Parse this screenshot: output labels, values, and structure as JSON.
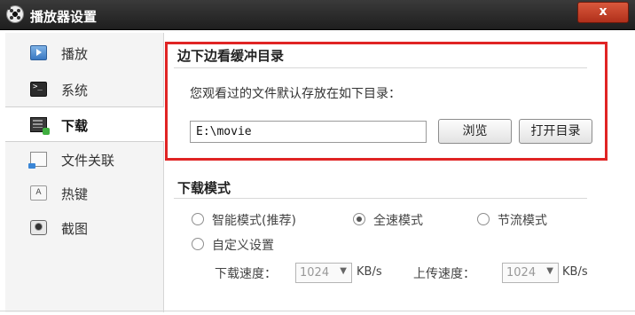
{
  "window": {
    "title": "播放器设置",
    "close_label": "x"
  },
  "sidebar": {
    "items": [
      {
        "label": "播放",
        "icon": "play-icon"
      },
      {
        "label": "系统",
        "icon": "terminal-icon"
      },
      {
        "label": "下载",
        "icon": "download-icon",
        "active": true
      },
      {
        "label": "文件关联",
        "icon": "file-icon"
      },
      {
        "label": "热键",
        "icon": "keyboard-icon"
      },
      {
        "label": "截图",
        "icon": "camera-icon"
      }
    ]
  },
  "buffer_dir": {
    "title": "边下边看缓冲目录",
    "description": "您观看过的文件默认存放在如下目录：",
    "path": "E:\\movie",
    "browse_label": "浏览",
    "open_label": "打开目录"
  },
  "download_mode": {
    "title": "下载模式",
    "options": [
      {
        "label": "智能模式(推荐)",
        "checked": false
      },
      {
        "label": "全速模式",
        "checked": true
      },
      {
        "label": "节流模式",
        "checked": false
      },
      {
        "label": "自定义设置",
        "checked": false
      }
    ],
    "download_speed_label": "下载速度：",
    "download_speed_value": "1024",
    "upload_speed_label": "上传速度：",
    "upload_speed_value": "1024",
    "unit": "KB/s"
  },
  "colors": {
    "highlight_border": "#e02424",
    "titlebar": "#2a2a2a",
    "close_button": "#c4402a"
  }
}
